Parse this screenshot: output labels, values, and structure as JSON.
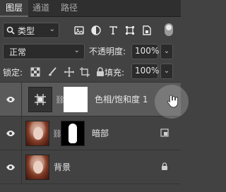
{
  "tabs": [
    "图层",
    "通道",
    "路径"
  ],
  "filter": {
    "label": "类型"
  },
  "blend": {
    "mode": "正常"
  },
  "opacity": {
    "label": "不透明度:",
    "value": "100%"
  },
  "lock": {
    "label": "锁定:"
  },
  "fill": {
    "label": "填充:",
    "value": "100%"
  },
  "layers": [
    {
      "name": "色相/饱和度 1"
    },
    {
      "name": "暗部"
    },
    {
      "name": "背景"
    }
  ],
  "colors": {
    "panel": "#424242",
    "selected": "#5a5a5a",
    "tabbar": "#2f2f2f"
  }
}
